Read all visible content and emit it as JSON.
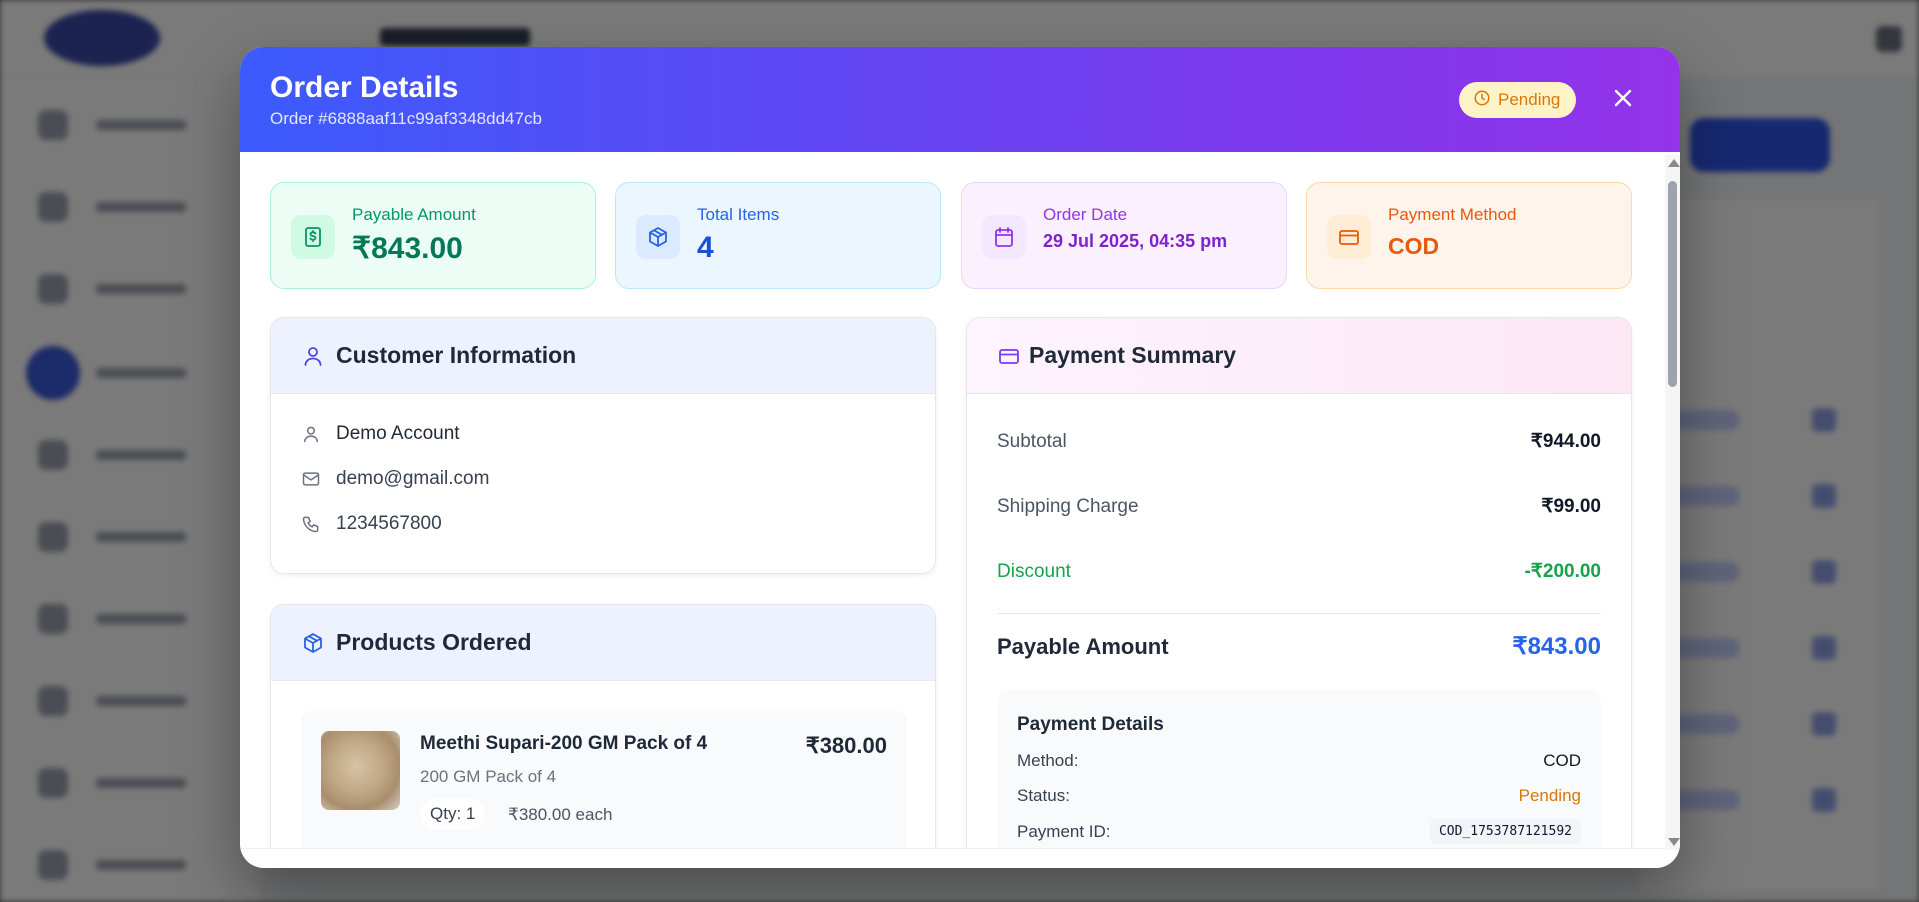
{
  "modal": {
    "title": "Order Details",
    "subtitle": "Order #6888aaf11c99af3348dd47cb",
    "status": "Pending",
    "close_icon": "close-icon"
  },
  "stats": {
    "payable": {
      "label": "Payable Amount",
      "value": "₹843.00",
      "icon": "dollar-icon"
    },
    "items": {
      "label": "Total Items",
      "value": "4",
      "icon": "box-icon"
    },
    "date": {
      "label": "Order Date",
      "value": "29 Jul 2025, 04:35 pm",
      "icon": "calendar-icon"
    },
    "method": {
      "label": "Payment Method",
      "value": "COD",
      "icon": "credit-card-icon"
    }
  },
  "customer": {
    "title": "Customer Information",
    "name": "Demo Account",
    "email": "demo@gmail.com",
    "phone": "1234567800"
  },
  "products": {
    "title": "Products Ordered",
    "items": [
      {
        "name": "Meethi Supari-200 GM Pack of 4",
        "variant": "200 GM Pack of 4",
        "qty": "Qty: 1",
        "each": "₹380.00 each",
        "price": "₹380.00"
      }
    ]
  },
  "payment": {
    "title": "Payment Summary",
    "subtotal_label": "Subtotal",
    "subtotal_value": "₹944.00",
    "shipping_label": "Shipping Charge",
    "shipping_value": "₹99.00",
    "discount_label": "Discount",
    "discount_value": "-₹200.00",
    "total_label": "Payable Amount",
    "total_value": "₹843.00",
    "details": {
      "title": "Payment Details",
      "method_label": "Method:",
      "method_value": "COD",
      "status_label": "Status:",
      "status_value": "Pending",
      "id_label": "Payment ID:",
      "id_value": "COD_1753787121592"
    }
  },
  "colors": {
    "header_start": "#3b5bfd",
    "header_end": "#9333ea",
    "pending": "#d97706",
    "discount": "#16a34a",
    "total": "#2563eb"
  }
}
